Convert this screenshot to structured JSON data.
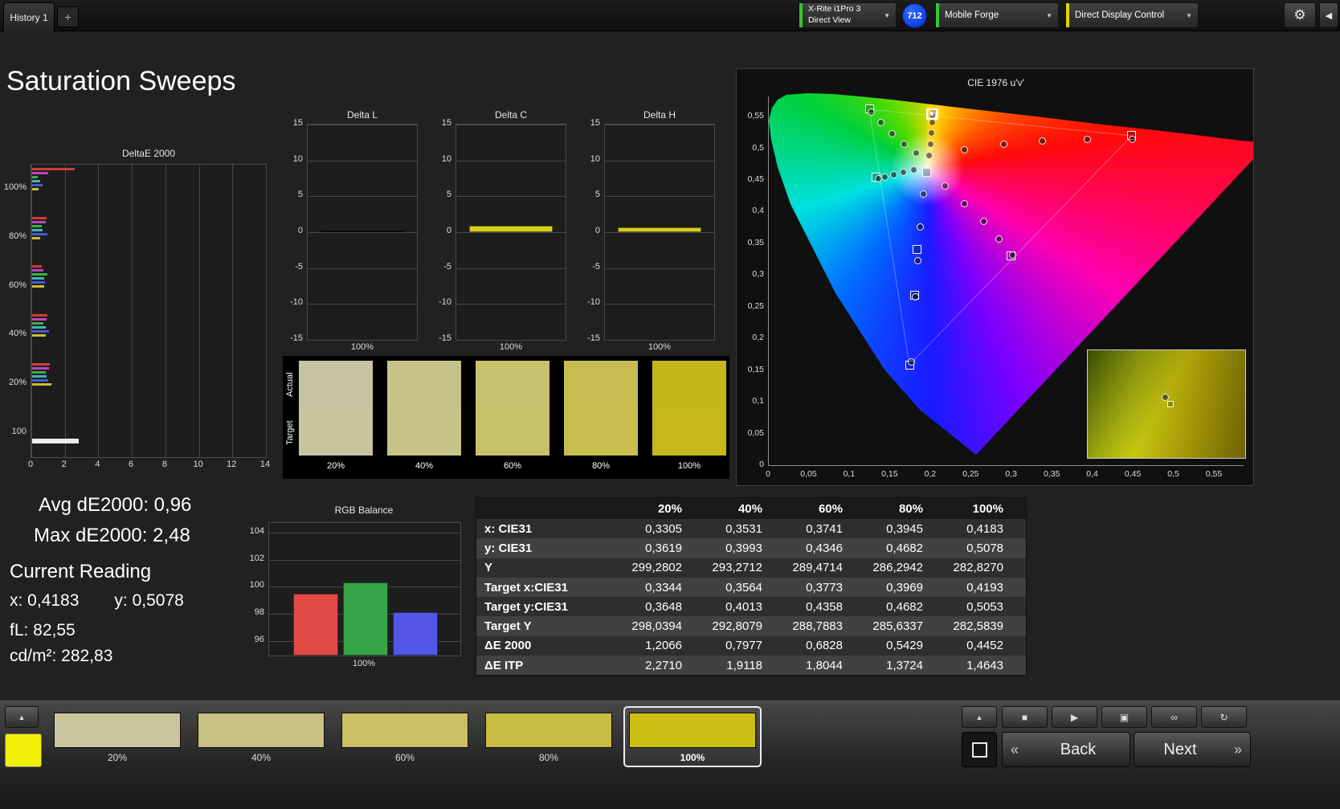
{
  "top_bar": {
    "tab_label": "History 1",
    "meter": {
      "line1": "X-Rite i1Pro 3",
      "line2": "Direct View",
      "accent": "#35c535"
    },
    "badge": "712",
    "pattern_source": {
      "label": "Mobile Forge",
      "accent": "#35c535"
    },
    "display_control": {
      "label": "Direct Display Control",
      "accent": "#e3d400"
    }
  },
  "page_title": "Saturation Sweeps",
  "readings": {
    "avg": "Avg dE2000: 0,96",
    "max": "Max dE2000: 2,48",
    "current_heading": "Current Reading",
    "x": "x: 0,4183",
    "y": "y: 0,5078",
    "fl": "fL: 82,55",
    "cdm2": "cd/m²: 282,83"
  },
  "chart_data": [
    {
      "id": "deltae2000",
      "type": "bar",
      "orientation": "horizontal",
      "title": "DeltaE 2000",
      "xlim": [
        0,
        14
      ],
      "xticks": [
        0,
        2,
        4,
        6,
        8,
        10,
        12,
        14
      ],
      "groups": [
        {
          "label": "100%",
          "bars": [
            {
              "color": "#d23b34",
              "value": 2.55
            },
            {
              "color": "#c243c2",
              "value": 0.95
            },
            {
              "color": "#3fae4a",
              "value": 0.35
            },
            {
              "color": "#3bb7b7",
              "value": 0.5
            },
            {
              "color": "#4b58d8",
              "value": 0.6
            },
            {
              "color": "#c9c12e",
              "value": 0.4
            }
          ]
        },
        {
          "label": "80%",
          "bars": [
            {
              "color": "#d23b34",
              "value": 0.85
            },
            {
              "color": "#c243c2",
              "value": 0.8
            },
            {
              "color": "#3fae4a",
              "value": 0.55
            },
            {
              "color": "#3bb7b7",
              "value": 0.6
            },
            {
              "color": "#4b58d8",
              "value": 0.9
            },
            {
              "color": "#c9c12e",
              "value": 0.5
            }
          ]
        },
        {
          "label": "60%",
          "bars": [
            {
              "color": "#d23b34",
              "value": 0.55
            },
            {
              "color": "#c243c2",
              "value": 0.65
            },
            {
              "color": "#3fae4a",
              "value": 0.9
            },
            {
              "color": "#3bb7b7",
              "value": 0.7
            },
            {
              "color": "#4b58d8",
              "value": 0.75
            },
            {
              "color": "#c9c12e",
              "value": 0.7
            }
          ]
        },
        {
          "label": "40%",
          "bars": [
            {
              "color": "#d23b34",
              "value": 0.9
            },
            {
              "color": "#c243c2",
              "value": 0.85
            },
            {
              "color": "#3fae4a",
              "value": 0.65
            },
            {
              "color": "#3bb7b7",
              "value": 0.8
            },
            {
              "color": "#4b58d8",
              "value": 1.0
            },
            {
              "color": "#c9c12e",
              "value": 0.8
            }
          ]
        },
        {
          "label": "20%",
          "bars": [
            {
              "color": "#d23b34",
              "value": 1.05
            },
            {
              "color": "#c243c2",
              "value": 1.0
            },
            {
              "color": "#3fae4a",
              "value": 0.8
            },
            {
              "color": "#3bb7b7",
              "value": 0.85
            },
            {
              "color": "#4b58d8",
              "value": 0.95
            },
            {
              "color": "#c9c12e",
              "value": 1.15
            }
          ]
        },
        {
          "label": "100",
          "bars": [
            {
              "color": "#ededed",
              "value": 2.8,
              "thick": 6
            }
          ]
        }
      ]
    },
    {
      "id": "delta_l",
      "type": "bar",
      "title": "Delta L",
      "ylim": [
        -15,
        15
      ],
      "yticks": [
        15,
        10,
        5,
        0,
        -5,
        -10,
        -15
      ],
      "categories": [
        "100%"
      ],
      "values": [
        0.15
      ],
      "bar_color": "#14161c"
    },
    {
      "id": "delta_c",
      "type": "bar",
      "title": "Delta C",
      "ylim": [
        -15,
        15
      ],
      "yticks": [
        15,
        10,
        5,
        0,
        -5,
        -10,
        -15
      ],
      "categories": [
        "100%"
      ],
      "values": [
        0.85
      ],
      "bar_color": "#d8ce1d"
    },
    {
      "id": "delta_h",
      "type": "bar",
      "title": "Delta H",
      "ylim": [
        -15,
        15
      ],
      "yticks": [
        15,
        10,
        5,
        0,
        -5,
        -10,
        -15
      ],
      "categories": [
        "100%"
      ],
      "values": [
        0.7
      ],
      "bar_color": "#d8ce1d"
    },
    {
      "id": "rgb_balance",
      "type": "bar",
      "title": "RGB Balance",
      "ylim": [
        94.9,
        104.7
      ],
      "yticks": [
        104,
        102,
        100,
        98,
        96
      ],
      "categories": [
        "100%"
      ],
      "series": [
        {
          "name": "Red",
          "color": "#e04a45",
          "value": 99.5
        },
        {
          "name": "Green",
          "color": "#37a447",
          "value": 100.3
        },
        {
          "name": "Blue",
          "color": "#5456e8",
          "value": 98.1
        }
      ]
    },
    {
      "id": "cie1976",
      "type": "scatter",
      "title": "CIE 1976 u'v'",
      "xlim": [
        0,
        0.55
      ],
      "ylim": [
        0,
        0.55
      ],
      "xticks": [
        "0",
        "0,05",
        "0,1",
        "0,15",
        "0,2",
        "0,25",
        "0,3",
        "0,35",
        "0,4",
        "0,45",
        "0,5",
        "0,55"
      ],
      "yticks": [
        "0",
        "0,05",
        "0,1",
        "0,15",
        "0,2",
        "0,25",
        "0,3",
        "0,35",
        "0,4",
        "0,45",
        "0,5",
        "0,55"
      ],
      "white_point": {
        "u": 0.197,
        "v": 0.468
      },
      "targets": [
        [
          0.125,
          0.562
        ],
        [
          0.205,
          0.556
        ],
        [
          0.449,
          0.52
        ],
        [
          0.3,
          0.33
        ],
        [
          0.175,
          0.158
        ],
        [
          0.133,
          0.455
        ],
        [
          0.196,
          0.462
        ],
        [
          0.181,
          0.268
        ],
        [
          0.184,
          0.34
        ]
      ],
      "sweeps": {
        "red": [
          [
            0.243,
            0.497
          ],
          [
            0.291,
            0.506
          ],
          [
            0.339,
            0.512
          ],
          [
            0.394,
            0.514
          ],
          [
            0.45,
            0.514
          ]
        ],
        "green": [
          [
            0.183,
            0.492
          ],
          [
            0.168,
            0.507
          ],
          [
            0.153,
            0.523
          ],
          [
            0.139,
            0.541
          ],
          [
            0.127,
            0.557
          ]
        ],
        "yellow": [
          [
            0.199,
            0.489
          ],
          [
            0.201,
            0.507
          ],
          [
            0.202,
            0.524
          ],
          [
            0.203,
            0.541
          ],
          [
            0.203,
            0.552
          ]
        ],
        "cyan": [
          [
            0.18,
            0.466
          ],
          [
            0.167,
            0.462
          ],
          [
            0.155,
            0.458
          ],
          [
            0.144,
            0.455
          ],
          [
            0.136,
            0.452
          ]
        ],
        "blue": [
          [
            0.192,
            0.428
          ],
          [
            0.188,
            0.376
          ],
          [
            0.185,
            0.322
          ],
          [
            0.182,
            0.266
          ],
          [
            0.177,
            0.163
          ]
        ],
        "magenta": [
          [
            0.219,
            0.441
          ],
          [
            0.243,
            0.413
          ],
          [
            0.266,
            0.385
          ],
          [
            0.285,
            0.357
          ],
          [
            0.302,
            0.332
          ]
        ]
      },
      "current": [
        0.2026,
        0.5535
      ],
      "inset_marker": {
        "x_frac": 0.47,
        "y_frac": 0.4
      }
    }
  ],
  "patches": {
    "row_labels": [
      "Actual",
      "Target"
    ],
    "columns": [
      {
        "label": "20%",
        "actual": "#c6c3a2",
        "target": "#c7c4a0"
      },
      {
        "label": "40%",
        "actual": "#c7c289",
        "target": "#c8c387"
      },
      {
        "label": "60%",
        "actual": "#c8c16e",
        "target": "#c8c16c"
      },
      {
        "label": "80%",
        "actual": "#c6bc50",
        "target": "#c7bd4e"
      },
      {
        "label": "100%",
        "actual": "#c3b71e",
        "target": "#c4b81c"
      }
    ]
  },
  "table": {
    "columns": [
      "20%",
      "40%",
      "60%",
      "80%",
      "100%"
    ],
    "rows": [
      {
        "label": "x: CIE31",
        "values": [
          "0,3305",
          "0,3531",
          "0,3741",
          "0,3945",
          "0,4183"
        ]
      },
      {
        "label": "y: CIE31",
        "values": [
          "0,3619",
          "0,3993",
          "0,4346",
          "0,4682",
          "0,5078"
        ]
      },
      {
        "label": "Y",
        "values": [
          "299,2802",
          "293,2712",
          "289,4714",
          "286,2942",
          "282,8270"
        ]
      },
      {
        "label": "Target x:CIE31",
        "values": [
          "0,3344",
          "0,3564",
          "0,3773",
          "0,3969",
          "0,4193"
        ]
      },
      {
        "label": "Target y:CIE31",
        "values": [
          "0,3648",
          "0,4013",
          "0,4358",
          "0,4682",
          "0,5053"
        ]
      },
      {
        "label": "Target Y",
        "values": [
          "298,0394",
          "292,8079",
          "288,7883",
          "285,6337",
          "282,5839"
        ]
      },
      {
        "label": "ΔE 2000",
        "values": [
          "1,2066",
          "0,7977",
          "0,6828",
          "0,5429",
          "0,4452"
        ]
      },
      {
        "label": "ΔE ITP",
        "values": [
          "2,2710",
          "1,9118",
          "1,8044",
          "1,3724",
          "1,4643"
        ]
      }
    ]
  },
  "bottom_bar": {
    "current_color": "#f2ef08",
    "swatches": [
      {
        "label": "20%",
        "color": "#c9c69f",
        "selected": false
      },
      {
        "label": "40%",
        "color": "#cac283",
        "selected": false
      },
      {
        "label": "60%",
        "color": "#cabf64",
        "selected": false
      },
      {
        "label": "80%",
        "color": "#c9bc42",
        "selected": false
      },
      {
        "label": "100%",
        "color": "#ccbf14",
        "selected": true
      }
    ],
    "back_label": "Back",
    "next_label": "Next"
  },
  "icons": {
    "plus": "+",
    "dropdown": "▼",
    "gear": "⚙",
    "collapse": "◀",
    "up_arrow": "▲",
    "stop": "■",
    "play": "▶",
    "frame": "▣",
    "infinity": "∞",
    "loop": "↻",
    "back_chevrons": "«",
    "next_chevrons": "»"
  }
}
